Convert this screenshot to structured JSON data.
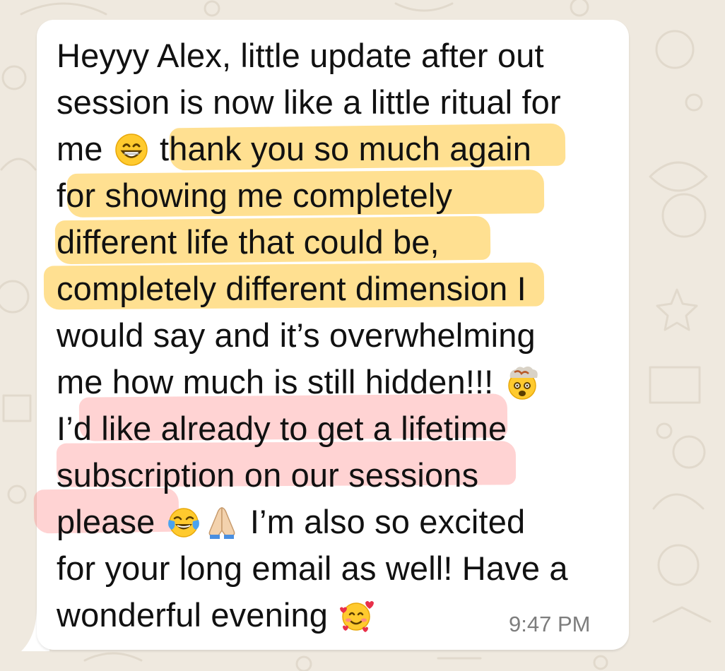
{
  "message": {
    "lines": [
      {
        "parts": [
          {
            "text": "Heyyy Alex, little update after out"
          }
        ]
      },
      {
        "parts": [
          {
            "text": "session is now like a little ritual for"
          }
        ]
      },
      {
        "parts": [
          {
            "text": "me "
          },
          {
            "emoji": "grinning-face-with-smiling-eyes"
          },
          {
            "text": " thank you so much again"
          }
        ]
      },
      {
        "parts": [
          {
            "text": "for showing me completely"
          }
        ]
      },
      {
        "parts": [
          {
            "text": "different life that could be,"
          }
        ]
      },
      {
        "parts": [
          {
            "text": "completely different dimension I"
          }
        ]
      },
      {
        "parts": [
          {
            "text": "would say and it’s overwhelming"
          }
        ]
      },
      {
        "parts": [
          {
            "text": "me how much is still hidden!!! "
          },
          {
            "emoji": "exploding-head"
          }
        ]
      },
      {
        "parts": [
          {
            "text": "I’d like already to get a lifetime"
          }
        ]
      },
      {
        "parts": [
          {
            "text": "subscription on our sessions"
          }
        ]
      },
      {
        "parts": [
          {
            "text": "please "
          },
          {
            "emoji": "face-with-tears-of-joy"
          },
          {
            "emoji": "folded-hands"
          },
          {
            "text": " I’m also so excited"
          }
        ]
      },
      {
        "parts": [
          {
            "text": "for your long email as well! Have a"
          }
        ]
      },
      {
        "parts": [
          {
            "text": "wonderful evening "
          },
          {
            "emoji": "smiling-face-with-hearts"
          }
        ]
      }
    ],
    "timestamp": "9:47 PM"
  },
  "highlight_colors": {
    "yellow": "#FFC636",
    "pink": "#FF8080"
  },
  "colors": {
    "wallpaper": "#EFE9DF",
    "bubble": "#FFFFFF",
    "text": "#111111",
    "timestamp": "#7D7D7D"
  }
}
